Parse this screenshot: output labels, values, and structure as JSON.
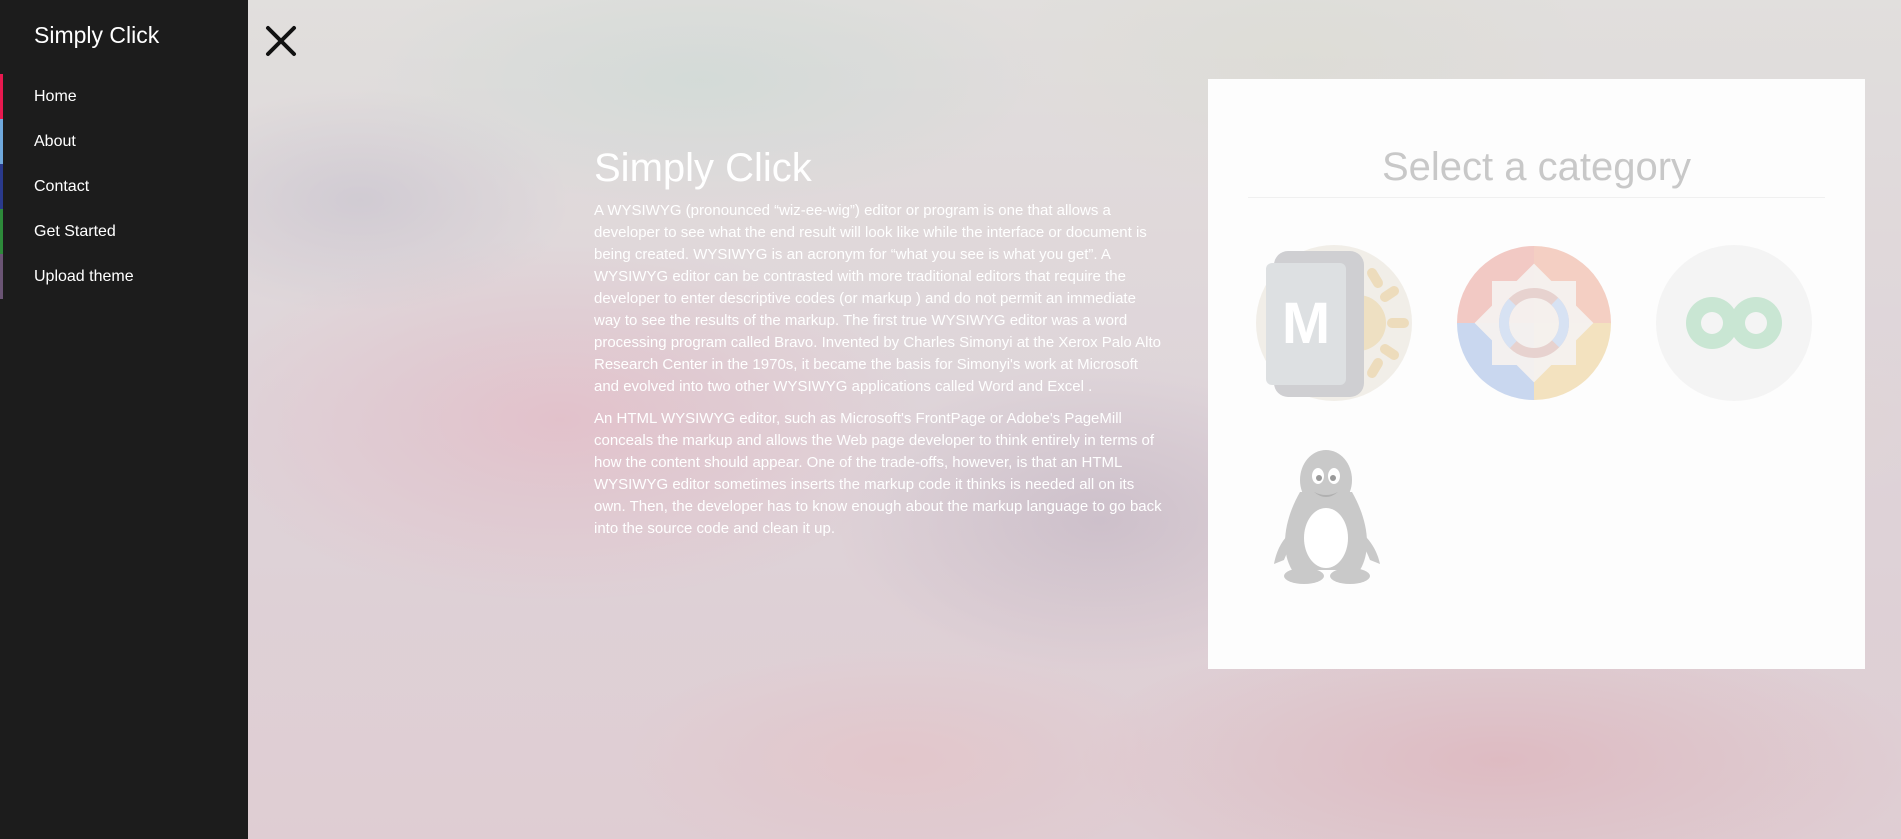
{
  "sidebar": {
    "title": "Simply Click",
    "items": [
      {
        "label": "Home",
        "accent": "#e8194f"
      },
      {
        "label": "About",
        "accent": "#6fa8dc"
      },
      {
        "label": "Contact",
        "accent": "#2a3a8c"
      },
      {
        "label": "Get Started",
        "accent": "#2d8a3a"
      },
      {
        "label": "Upload theme",
        "accent": "#6a5474"
      }
    ]
  },
  "close": {
    "icon": "close-icon"
  },
  "main": {
    "title": "Simply Click",
    "paragraphs": [
      "A WYSIWYG (pronounced “wiz-ee-wig”) editor or program is one that allows a developer to see what the end result will look like while the interface or document is being created. WYSIWYG is an acronym for “what you see is what you get”. A WYSIWYG editor can be contrasted with more traditional editors that require the developer to enter descriptive codes (or markup ) and do not permit an immediate way to see the results of the markup. The first true WYSIWYG editor was a word processing program called Bravo. Invented by Charles Simonyi at the Xerox Palo Alto Research Center in the 1970s, it became the basis for Simonyi's work at Microsoft and evolved into two other WYSIWYG applications called Word and Excel .",
      "An HTML WYSIWYG editor, such as Microsoft's FrontPage or Adobe's PageMill conceals the markup and allows the Web page developer to think entirely in terms of how the content should appear. One of the trade-offs, however, is that an HTML WYSIWYG editor sometimes inserts the markup code it thinks is needed all on its own. Then, the developer has to know enough about the markup language to go back into the source code and clean it up."
    ]
  },
  "panel": {
    "title": "Select a category",
    "categories": [
      {
        "icon": "material-m-icon"
      },
      {
        "icon": "colorful-gear-icon"
      },
      {
        "icon": "infinity-icon"
      },
      {
        "icon": "linux-penguin-icon"
      }
    ]
  }
}
